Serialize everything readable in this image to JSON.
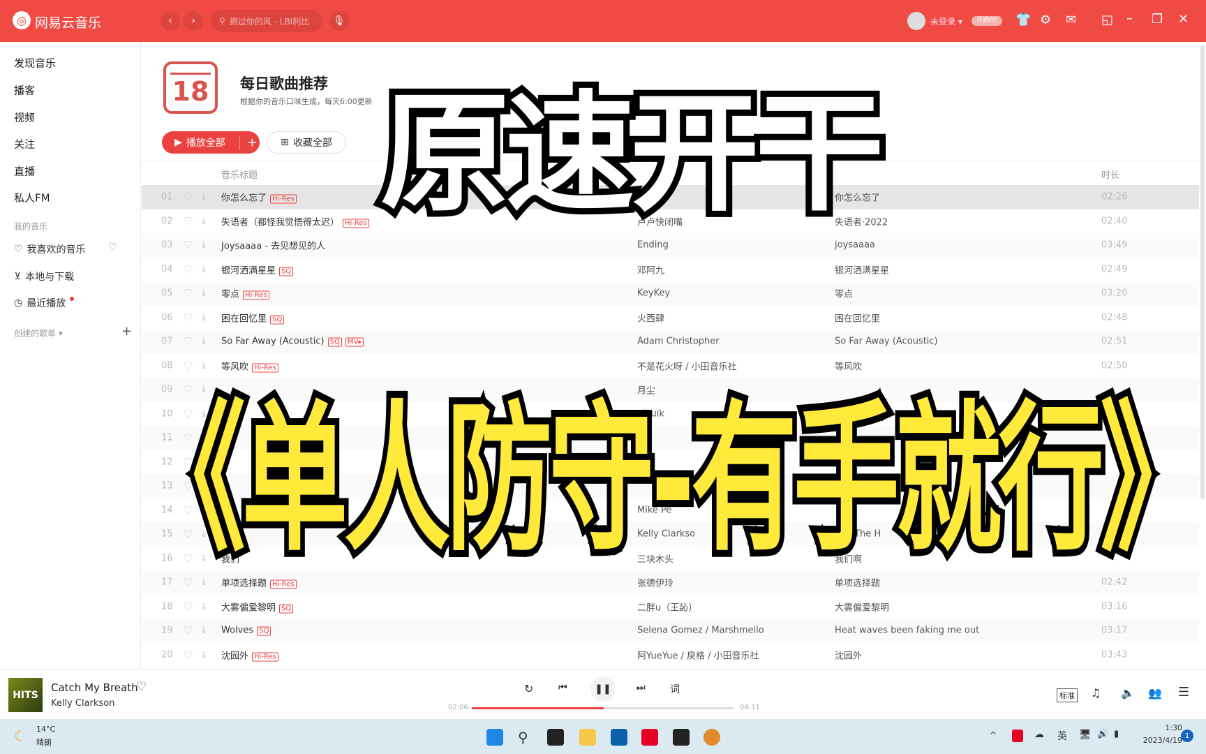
{
  "app": {
    "name": "网易云音乐",
    "search_placeholder": "拥过你的风 - LBI利比",
    "user": "未登录",
    "vip": "开通VIP"
  },
  "sidebar": {
    "items": [
      "发现音乐",
      "播客",
      "视频",
      "关注",
      "直播",
      "私人FM"
    ],
    "section": "我的音乐",
    "my": [
      "我喜欢的音乐",
      "本地与下载",
      "最近播放"
    ],
    "created": "创建的歌单"
  },
  "header": {
    "calendar_day": "18",
    "title": "每日歌曲推荐",
    "subtitle": "根据你的音乐口味生成，每天6:00更新",
    "play_all": "播放全部",
    "collect_all": "收藏全部"
  },
  "table": {
    "col_title": "音乐标题",
    "col_duration": "时长",
    "rows": [
      {
        "i": "01",
        "t": "你怎么忘了",
        "tags": [
          "Hi-Res"
        ],
        "a": "苏星婕",
        "al": "你怎么忘了",
        "d": "02:26"
      },
      {
        "i": "02",
        "t": "失语者（都怪我觉悟得太迟）",
        "tags": [
          "Hi-Res"
        ],
        "a": "卢卢快闭嘴",
        "al": "失语者·2022",
        "d": "02:40"
      },
      {
        "i": "03",
        "t": "Joysaaaa - 去见想见的人",
        "tags": [],
        "a": "Ending",
        "al": "joysaaaa",
        "d": "03:49"
      },
      {
        "i": "04",
        "t": "银河洒满星星",
        "tags": [
          "SQ"
        ],
        "a": "邓阿九",
        "al": "银河洒满星星",
        "d": "02:49"
      },
      {
        "i": "05",
        "t": "零点",
        "tags": [
          "Hi-Res"
        ],
        "a": "KeyKey",
        "al": "零点",
        "d": "03:20"
      },
      {
        "i": "06",
        "t": "困在回忆里",
        "tags": [
          "SQ"
        ],
        "a": "火西肆",
        "al": "困在回忆里",
        "d": "02:48"
      },
      {
        "i": "07",
        "t": "So Far Away (Acoustic)",
        "tags": [
          "SQ",
          "MV▸"
        ],
        "a": "Adam Christopher",
        "al": "So Far Away (Acoustic)",
        "d": "02:51"
      },
      {
        "i": "08",
        "t": "等风吹",
        "tags": [
          "Hi-Res"
        ],
        "a": "不是花火呀 / 小田音乐社",
        "al": "等风吹",
        "d": "02:50"
      },
      {
        "i": "09",
        "t": "",
        "tags": [],
        "a": "月尘",
        "al": "",
        "d": ""
      },
      {
        "i": "10",
        "t": "",
        "tags": [],
        "a": "yihuik",
        "al": "",
        "d": ""
      },
      {
        "i": "11",
        "t": "",
        "tags": [],
        "a": "21.",
        "al": "",
        "d": ""
      },
      {
        "i": "12",
        "t": "",
        "tags": [],
        "a": "",
        "al": "",
        "d": ""
      },
      {
        "i": "13",
        "t": "",
        "tags": [],
        "a": "",
        "al": "",
        "d": ""
      },
      {
        "i": "14",
        "t": "",
        "tags": [],
        "a": "Mike Pe",
        "al": "",
        "d": ""
      },
      {
        "i": "15",
        "t": "",
        "tags": [],
        "a": "Kelly Clarkso",
        "al": "Just The H",
        "d": ""
      },
      {
        "i": "16",
        "t": "我们",
        "tags": [],
        "a": "三块木头",
        "al": "我们啊",
        "d": ""
      },
      {
        "i": "17",
        "t": "单项选择题",
        "tags": [
          "Hi-Res"
        ],
        "a": "张德伊玲",
        "al": "单项选择题",
        "d": "02:42"
      },
      {
        "i": "18",
        "t": "大雾偏爱黎明",
        "tags": [
          "SQ"
        ],
        "a": "二胖u（王訫）",
        "al": "大雾偏爱黎明",
        "d": "03:16"
      },
      {
        "i": "19",
        "t": "Wolves",
        "tags": [
          "SQ"
        ],
        "a": "Selena Gomez / Marshmello",
        "al": "Heat waves been faking me out",
        "d": "03:17"
      },
      {
        "i": "20",
        "t": "沈园外",
        "tags": [
          "Hi-Res"
        ],
        "a": "阿YueYue / 戾格 / 小田音乐社",
        "al": "沈园外",
        "d": "03:43"
      }
    ]
  },
  "player": {
    "song": "Catch My Breath",
    "artist": "Kelly Clarkson",
    "cover_text": "HITS",
    "elapsed": "02:06",
    "total": "04:11",
    "progress": 0.502,
    "lyric": "词",
    "quality": "标准",
    "accent": "#ec4141"
  },
  "taskbar": {
    "temp": "14°C",
    "weather": "晴朗",
    "ime": "英",
    "time": "1:30",
    "date": "2023/4/19",
    "notif": "1"
  },
  "overlay": {
    "top": "原速开干",
    "bottom": "《单人防守-有手就行》"
  }
}
